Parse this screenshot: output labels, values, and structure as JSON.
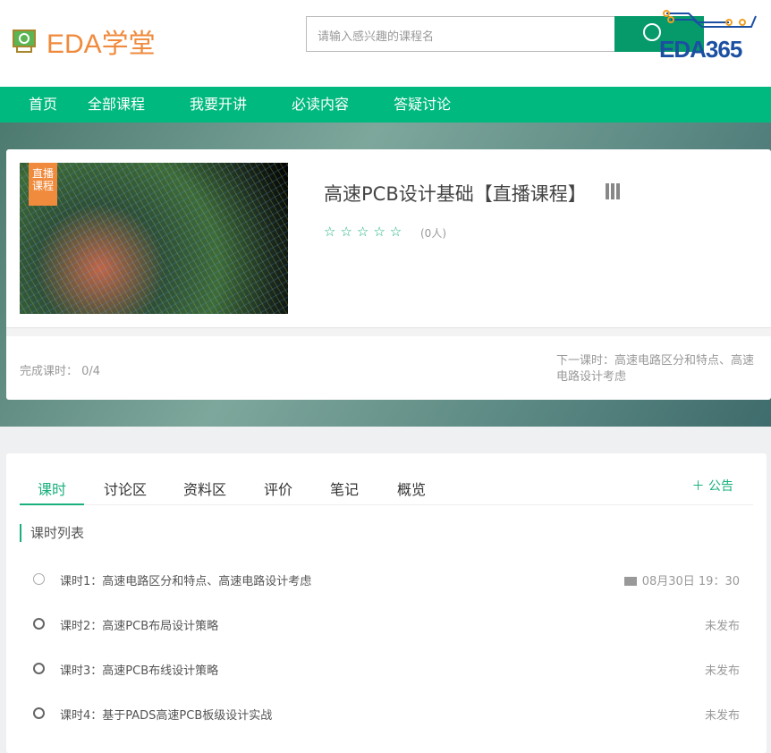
{
  "header": {
    "logo_text": "EDA学堂",
    "search_placeholder": "请输入感兴趣的课程名",
    "brand": "EDA365"
  },
  "nav": [
    "首页",
    "全部课程",
    "我要开讲",
    "必读内容",
    "答疑讨论"
  ],
  "course": {
    "badge": "直播课程",
    "title": "高速PCB设计基础【直播课程】",
    "stars": "☆☆☆☆☆",
    "rating_count": "(0人)",
    "completed": "完成课时： 0/4",
    "next_lesson": "下一课时：高速电路区分和特点、高速电路设计考虑"
  },
  "tabs": [
    "课时",
    "讨论区",
    "资料区",
    "评价",
    "笔记",
    "概览"
  ],
  "notice": "＋ 公告",
  "section_title": "课时列表",
  "lessons": [
    {
      "name": "课时1：高速电路区分和特点、高速电路设计考虑",
      "status": "08月30日 19：30"
    },
    {
      "name": "课时2：高速PCB布局设计策略",
      "status": "未发布"
    },
    {
      "name": "课时3：高速PCB布线设计策略",
      "status": "未发布"
    },
    {
      "name": "课时4：基于PADS高速PCB板级设计实战",
      "status": "未发布"
    }
  ]
}
